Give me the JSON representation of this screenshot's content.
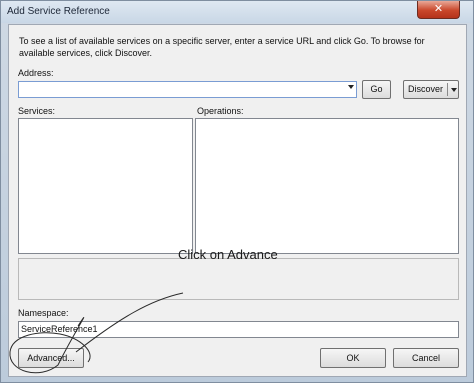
{
  "window": {
    "title": "Add Service Reference",
    "close_glyph": "✕"
  },
  "dialog": {
    "description": "To see a list of available services on a specific server, enter a service URL and click Go. To browse for available services, click Discover.",
    "address_label": "Address:",
    "address_value": "",
    "go_label": "Go",
    "discover_label": "Discover",
    "services_label": "Services:",
    "operations_label": "Operations:",
    "namespace_label": "Namespace:",
    "namespace_value": "ServiceReference1",
    "advanced_label": "Advanced...",
    "ok_label": "OK",
    "cancel_label": "Cancel"
  },
  "annotation": {
    "text": "Click on Advance",
    "color": "#1a1a1a"
  },
  "icons": {
    "dropdown": "chevron-down-icon",
    "close": "close-icon"
  }
}
